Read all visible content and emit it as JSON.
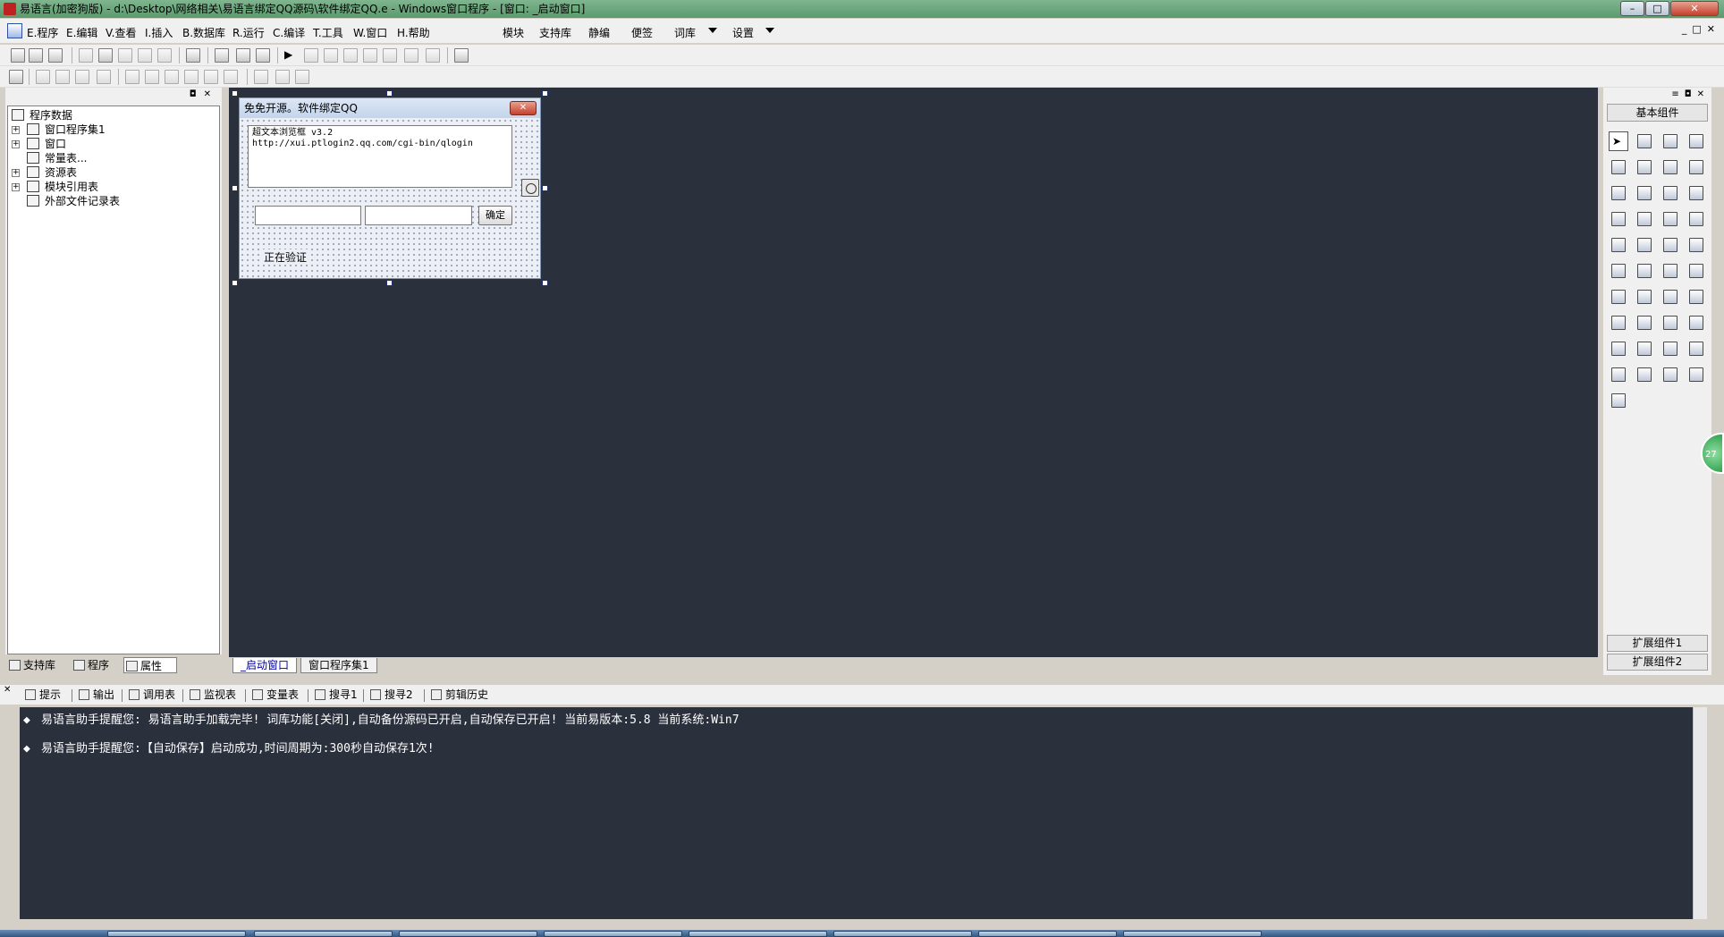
{
  "window": {
    "title": "易语言(加密狗版) - d:\\Desktop\\网络相关\\易语言绑定QQ源码\\软件绑定QQ.e - Windows窗口程序 - [窗口: _启动窗口]"
  },
  "menu": {
    "items": [
      "E.程序",
      "E.编辑",
      "V.查看",
      "I.插入",
      "B.数据库",
      "R.运行",
      "C.编译",
      "T.工具",
      "W.窗口",
      "H.帮助"
    ],
    "extras": [
      "模块",
      "支持库",
      "静编",
      "便签",
      "词库",
      "设置"
    ]
  },
  "left_panel": {
    "tree": [
      "程序数据",
      "窗口程序集1",
      "窗口",
      "常量表...",
      "资源表",
      "模块引用表",
      "外部文件记录表"
    ],
    "tabs": [
      "支持库",
      "程序",
      "属性"
    ]
  },
  "doc_tabs": [
    "_启动窗口",
    "窗口程序集1"
  ],
  "form": {
    "title": "免免开源。软件绑定QQ",
    "close": "✕",
    "browser_line1": "超文本浏览框 v3.2",
    "browser_line2": "http://xui.ptlogin2.qq.com/cgi-bin/qlogin",
    "confirm": "确定",
    "status": "正在验证"
  },
  "toolbox": {
    "header": "基本组件",
    "footer1": "扩展组件1",
    "footer2": "扩展组件2",
    "bubble": "27"
  },
  "output": {
    "tabs": [
      "提示",
      "输出",
      "调用表",
      "监视表",
      "变量表",
      "搜寻1",
      "搜寻2",
      "剪辑历史"
    ],
    "lines": [
      "易语言助手提醒您:  易语言助手加载完毕!  词库功能[关闭],自动备份源码已开启,自动保存已开启!  当前易版本:5.8  当前系统:Win7",
      "易语言助手提醒您:【自动保存】启动成功,时间周期为:300秒自动保存1次!"
    ],
    "bullet": "◆"
  }
}
